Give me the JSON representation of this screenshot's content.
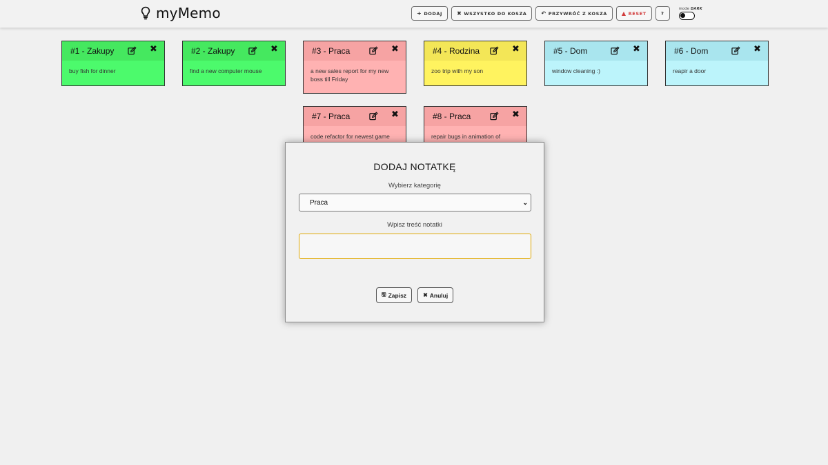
{
  "app": {
    "name": "myMemo",
    "icons": {
      "logo": "lightbulb-icon"
    }
  },
  "toolbar": {
    "add_label": "DODAJ",
    "trash_all_label": "WSZYSTKO DO KOSZA",
    "restore_label": "PRZYWRÓĆ Z KOSZA",
    "reset_label": "RESET",
    "help_label": "?",
    "mode_label": "mode",
    "mode_value": "DARK",
    "dark_mode_on": false
  },
  "notes": [
    {
      "title": "#1 - Zakupy",
      "category": "Zakupy",
      "text": "buy fish for dinner",
      "color": "#4cfa6c"
    },
    {
      "title": "#2 - Zakupy",
      "category": "Zakupy",
      "text": "find a new computer mouse",
      "color": "#4cfa6c"
    },
    {
      "title": "#3 - Praca",
      "category": "Praca",
      "text": "a new sales report for my new boss till Friday",
      "color": "#ffb2b2"
    },
    {
      "title": "#4 - Rodzina",
      "category": "Rodzina",
      "text": "zoo trip with my son",
      "color": "#fff35f"
    },
    {
      "title": "#5 - Dom",
      "category": "Dom",
      "text": "window cleaning :)",
      "color": "#bcf4fb"
    },
    {
      "title": "#6 - Dom",
      "category": "Dom",
      "text": "reapir a door",
      "color": "#bcf4fb"
    },
    {
      "title": "#7 - Praca",
      "category": "Praca",
      "text": "code refactor for newest game",
      "color": "#ffb2b2"
    },
    {
      "title": "#8 - Praca",
      "category": "Praca",
      "text": "repair bugs in animation of",
      "color": "#ffb2b2"
    }
  ],
  "modal": {
    "title": "DODAJ NOTATKĘ",
    "category_label": "Wybierz kategorię",
    "category_selected": "Praca",
    "text_label": "Wpisz treść notatki",
    "text_value": "",
    "save_label": "Zapisz",
    "cancel_label": "Anuluj"
  },
  "colors": {
    "background": "#f0f0f0",
    "zakupy": "#4cfa6c",
    "praca": "#ffb2b2",
    "rodzina": "#fff35f",
    "dom": "#bcf4fb",
    "focus_border": "#e0a700",
    "reset_text": "#d13c3c"
  }
}
